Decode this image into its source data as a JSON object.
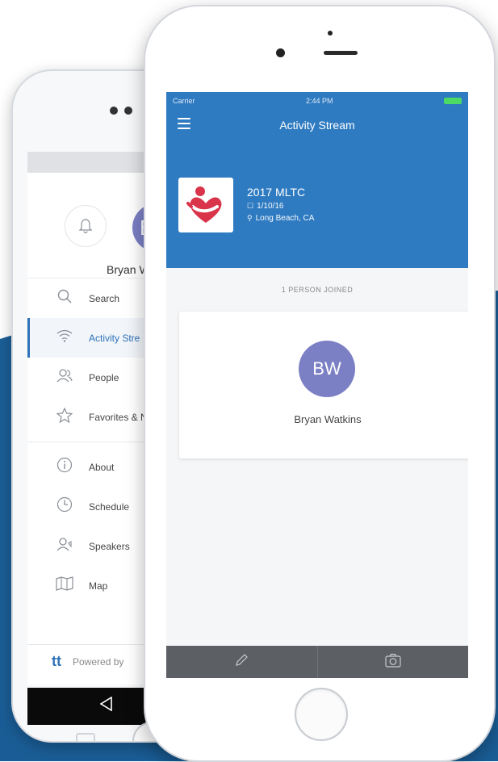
{
  "colors": {
    "brand_blue": "#2f7bc1",
    "background_wave": "#1a5d96",
    "avatar_purple": "#7b7fc4",
    "tabbar_gray": "#5c5f63"
  },
  "android_phone": {
    "user_initials": "BW",
    "user_name": "Bryan W",
    "menu_primary": [
      {
        "label": "Search",
        "icon": "search-icon"
      },
      {
        "label": "Activity Stre",
        "icon": "wifi-icon",
        "active": true
      },
      {
        "label": "People",
        "icon": "people-icon"
      },
      {
        "label": "Favorites & N",
        "icon": "star-icon"
      }
    ],
    "menu_secondary": [
      {
        "label": "About",
        "icon": "info-icon"
      },
      {
        "label": "Schedule",
        "icon": "clock-icon"
      },
      {
        "label": "Speakers",
        "icon": "speaker-icon"
      },
      {
        "label": "Map",
        "icon": "map-icon"
      }
    ],
    "powered_label": "Powered by",
    "powered_logo": "tt"
  },
  "ios_phone": {
    "status": {
      "carrier": "Carrier",
      "time": "2:44 PM"
    },
    "nav_title": "Activity Stream",
    "event": {
      "title": "2017  MLTC",
      "date": "1/10/16",
      "location": "Long Beach, CA"
    },
    "joined_label": "1 PERSON JOINED",
    "member": {
      "initials": "BW",
      "name": "Bryan Watkins"
    },
    "tabbar": [
      {
        "icon": "pencil-icon"
      },
      {
        "icon": "camera-icon"
      }
    ]
  }
}
